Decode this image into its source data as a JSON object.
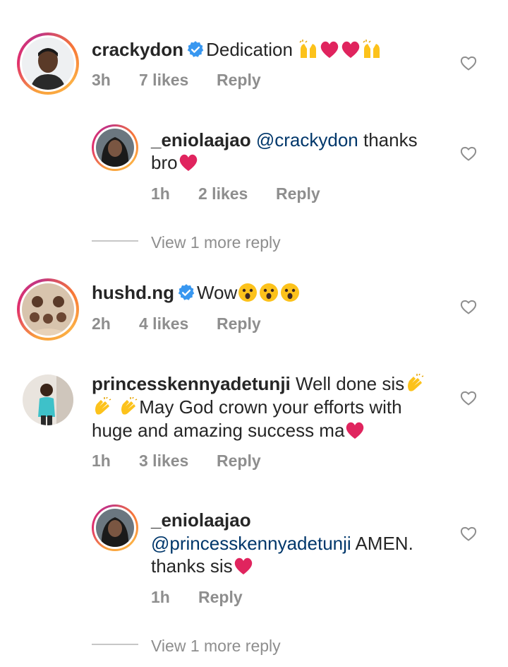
{
  "comments": [
    {
      "username": "crackydon",
      "verified": true,
      "text": "Dedication",
      "emojis": [
        "raising-hands",
        "red-heart",
        "red-heart",
        "raising-hands"
      ],
      "time": "3h",
      "likes": "7 likes",
      "reply_label": "Reply",
      "replies": [
        {
          "username": "_eniolaajao",
          "mention": "@crackydon",
          "text_line1": " thanks",
          "text_line2": "bro",
          "emojis": [
            "red-heart"
          ],
          "time": "1h",
          "likes": "2 likes",
          "reply_label": "Reply"
        }
      ],
      "view_more": "View 1 more reply"
    },
    {
      "username": "hushd.ng",
      "verified": true,
      "text": "Wow",
      "emojis": [
        "astonished-face",
        "astonished-face",
        "astonished-face"
      ],
      "time": "2h",
      "likes": "4 likes",
      "reply_label": "Reply"
    },
    {
      "username": "princesskennyadetunji",
      "text_line1": " Well done sis",
      "text_line2": "May God crown your efforts with",
      "text_line3": "huge and amazing success ma",
      "emojis": [
        "clapping-hands",
        "clapping-hands",
        "clapping-hands",
        "red-heart"
      ],
      "time": "1h",
      "likes": "3 likes",
      "reply_label": "Reply",
      "replies": [
        {
          "username": "_eniolaajao",
          "mention": "@princesskennyadetunji",
          "text_line2": " AMEN.",
          "text_line3": "thanks sis",
          "emojis": [
            "red-heart"
          ],
          "time": "1h",
          "reply_label": "Reply"
        }
      ],
      "view_more": "View 1 more reply"
    }
  ],
  "colors": {
    "text": "#262626",
    "meta": "#8e8e8e",
    "mention": "#00376b",
    "verified": "#3897f0",
    "heart_emoji": "#e0245e"
  },
  "icons": [
    "heart-outline-icon",
    "verified-badge-icon"
  ]
}
